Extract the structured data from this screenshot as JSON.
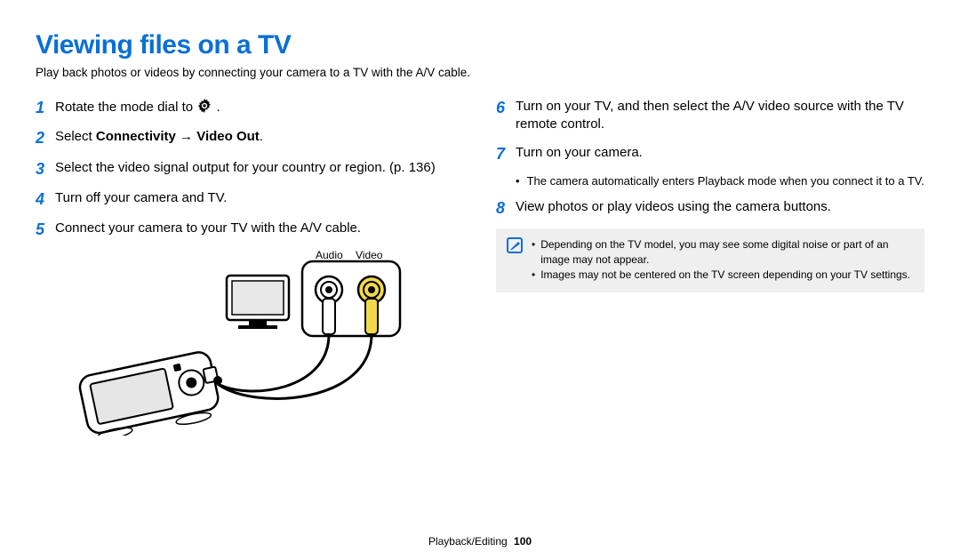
{
  "title": "Viewing files on a TV",
  "subtitle": "Play back photos or videos by connecting your camera to a TV with the A/V cable.",
  "left_steps": [
    {
      "num": "1",
      "text_pre": "Rotate the mode dial to ",
      "has_icon": true,
      "text_post": "."
    },
    {
      "num": "2",
      "text_pre": "Select ",
      "bold": "Connectivity → Video Out",
      "text_post": "."
    },
    {
      "num": "3",
      "text_pre": "Select the video signal output for your country or region. (p. 136)"
    },
    {
      "num": "4",
      "text_pre": "Turn off your camera and TV."
    },
    {
      "num": "5",
      "text_pre": "Connect your camera to your TV with the A/V cable."
    }
  ],
  "av_labels": {
    "audio": "Audio",
    "video": "Video"
  },
  "right_steps": [
    {
      "num": "6",
      "text_pre": "Turn on your TV, and then select the A/V video source with the TV remote control."
    },
    {
      "num": "7",
      "text_pre": "Turn on your camera."
    }
  ],
  "right_sub_bullet": "The camera automatically enters Playback mode when you connect it to a TV.",
  "right_step8": {
    "num": "8",
    "text_pre": "View photos or play videos using the camera buttons."
  },
  "note_items": [
    "Depending on the TV model, you may see some digital noise or part of an image may not appear.",
    "Images may not be centered on the TV screen depending on your TV settings."
  ],
  "footer_section": "Playback/Editing",
  "footer_page": "100"
}
